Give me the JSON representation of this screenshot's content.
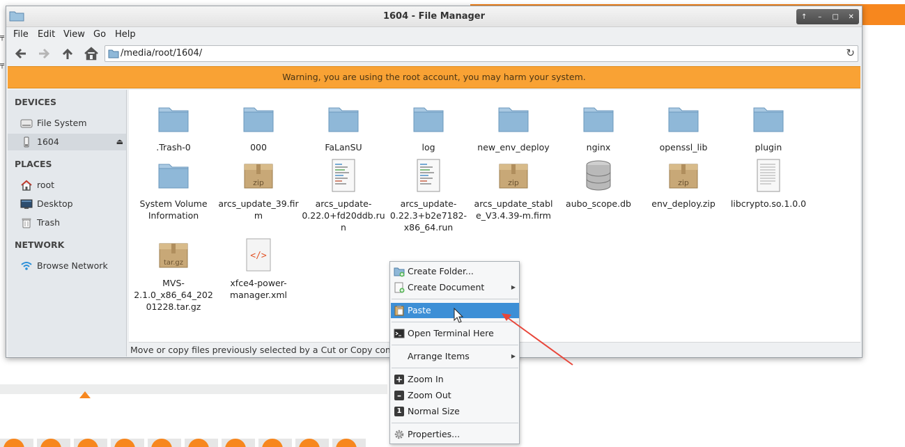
{
  "window": {
    "title": "1604 - File Manager",
    "controls": [
      "↑",
      "–",
      "□",
      "✕"
    ]
  },
  "menubar": [
    "File",
    "Edit",
    "View",
    "Go",
    "Help"
  ],
  "toolbar": {
    "back": "🡐",
    "forward": "🡒",
    "up": "🡑",
    "home": "⌂",
    "path": "/media/root/1604/",
    "reload": "↻"
  },
  "warning": "Warning, you are using the root account, you may harm your system.",
  "sidebar": {
    "devices_header": "DEVICES",
    "devices": [
      {
        "label": "File System",
        "icon": "drive-icon"
      },
      {
        "label": "1604",
        "icon": "usb-drive-icon",
        "eject": "⏏"
      }
    ],
    "places_header": "PLACES",
    "places": [
      {
        "label": "root",
        "icon": "home-icon"
      },
      {
        "label": "Desktop",
        "icon": "desktop-icon"
      },
      {
        "label": "Trash",
        "icon": "trash-icon"
      }
    ],
    "network_header": "NETWORK",
    "network": [
      {
        "label": "Browse Network",
        "icon": "wifi-icon"
      }
    ]
  },
  "files": [
    {
      "name": ".Trash-0",
      "kind": "folder"
    },
    {
      "name": "000",
      "kind": "folder"
    },
    {
      "name": "FaLanSU",
      "kind": "folder"
    },
    {
      "name": "log",
      "kind": "folder"
    },
    {
      "name": "new_env_deploy",
      "kind": "folder"
    },
    {
      "name": "nginx",
      "kind": "folder"
    },
    {
      "name": "openssl_lib",
      "kind": "folder"
    },
    {
      "name": "plugin",
      "kind": "folder"
    },
    {
      "name": "System Volume Information",
      "kind": "folder"
    },
    {
      "name": "arcs_update_39.firm",
      "kind": "archive",
      "badge": "zip"
    },
    {
      "name": "arcs_update-0.22.0+fd20ddb.run",
      "kind": "script"
    },
    {
      "name": "arcs_update-0.22.3+b2e7182-x86_64.run",
      "kind": "script"
    },
    {
      "name": "arcs_update_stable_V3.4.39-m.firm",
      "kind": "archive",
      "badge": "zip"
    },
    {
      "name": "aubo_scope.db",
      "kind": "database"
    },
    {
      "name": "env_deploy.zip",
      "kind": "archive",
      "badge": "zip"
    },
    {
      "name": "libcrypto.so.1.0.0",
      "kind": "text"
    },
    {
      "name": "MVS-2.1.0_x86_64_20201228.tar.gz",
      "kind": "archive",
      "badge": "tar.gz"
    },
    {
      "name": "xfce4-power-manager.xml",
      "kind": "xml",
      "badge": "</>"
    }
  ],
  "status": "Move or copy files previously selected by a Cut or Copy command",
  "context_menu": {
    "items": [
      {
        "label": "Create Folder...",
        "icon": "new-folder-icon"
      },
      {
        "label": "Create Document",
        "icon": "new-document-icon",
        "submenu": "▶"
      },
      {
        "label": "Paste",
        "icon": "paste-icon",
        "highlighted": true
      },
      {
        "label": "Open Terminal Here",
        "icon": "terminal-icon"
      },
      {
        "label": "Arrange Items",
        "icon": "",
        "submenu": "▶"
      },
      {
        "label": "Zoom In",
        "icon": "zoom-in-icon",
        "glyph": "+"
      },
      {
        "label": "Zoom Out",
        "icon": "zoom-out-icon",
        "glyph": "–"
      },
      {
        "label": "Normal Size",
        "icon": "normal-size-icon",
        "glyph": "1"
      },
      {
        "label": "Properties...",
        "icon": "gear-icon"
      }
    ]
  },
  "colors": {
    "accent_orange": "#f7871e",
    "warning_bg": "#f9a234",
    "selection_blue": "#3d8fd6",
    "folder_blue": "#8fb8d8"
  }
}
